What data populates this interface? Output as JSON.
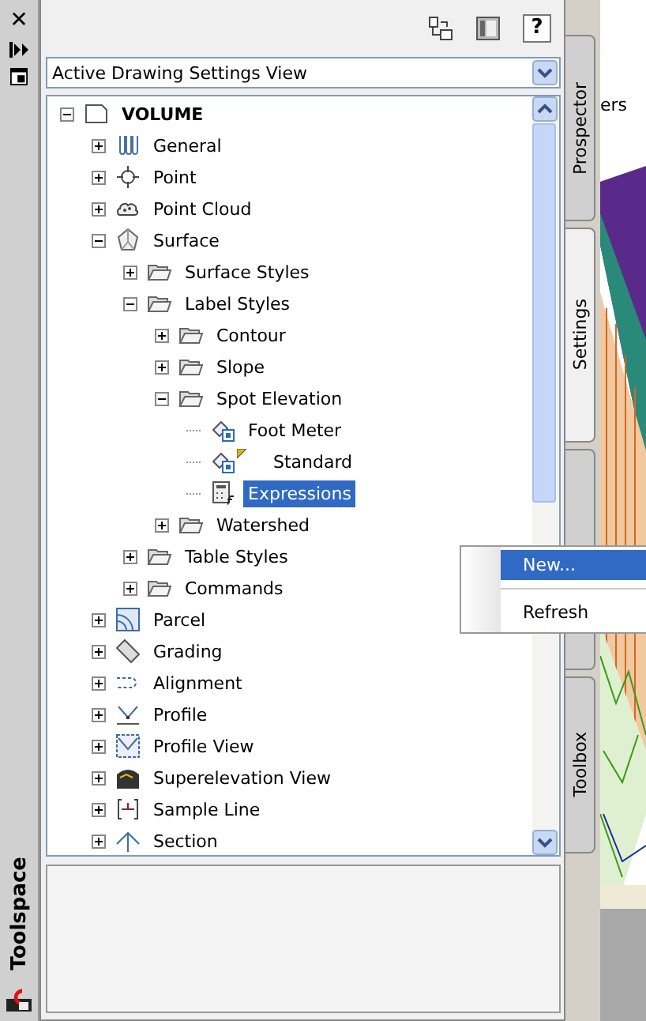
{
  "left_strip": {
    "title": "Toolspace",
    "close_glyph": "✕"
  },
  "toolbar": {
    "buttons": [
      {
        "kind": "tree-toggle"
      },
      {
        "kind": "panel"
      },
      {
        "kind": "help",
        "label": "?"
      }
    ]
  },
  "view_dropdown": {
    "value": "Active Drawing Settings View"
  },
  "tree": [
    {
      "label": "VOLUME",
      "kind": "drawing",
      "expanded": true,
      "selected": false,
      "children": [
        {
          "label": "General",
          "kind": "general",
          "expanded": false,
          "selected": false
        },
        {
          "label": "Point",
          "kind": "point",
          "expanded": false,
          "selected": false
        },
        {
          "label": "Point Cloud",
          "kind": "pointcloud",
          "expanded": false,
          "selected": false
        },
        {
          "label": "Surface",
          "kind": "surface",
          "expanded": true,
          "selected": false,
          "children": [
            {
              "label": "Surface Styles",
              "kind": "folder",
              "expanded": false,
              "selected": false
            },
            {
              "label": "Label Styles",
              "kind": "folder",
              "expanded": true,
              "selected": false,
              "children": [
                {
                  "label": "Contour",
                  "kind": "folder",
                  "expanded": false,
                  "selected": false
                },
                {
                  "label": "Slope",
                  "kind": "folder",
                  "expanded": false,
                  "selected": false
                },
                {
                  "label": "Spot Elevation",
                  "kind": "folder",
                  "expanded": true,
                  "selected": false,
                  "children": [
                    {
                      "label": "Foot Meter",
                      "kind": "label-style",
                      "default": false,
                      "selected": false
                    },
                    {
                      "label": "Standard",
                      "kind": "label-style",
                      "default": true,
                      "selected": false
                    },
                    {
                      "label": "Expressions",
                      "kind": "expressions",
                      "selected": true
                    }
                  ]
                },
                {
                  "label": "Watershed",
                  "kind": "folder",
                  "expanded": false,
                  "selected": false
                }
              ]
            },
            {
              "label": "Table Styles",
              "kind": "folder",
              "expanded": false,
              "selected": false
            },
            {
              "label": "Commands",
              "kind": "folder",
              "expanded": false,
              "selected": false
            }
          ]
        },
        {
          "label": "Parcel",
          "kind": "parcel",
          "expanded": false,
          "selected": false
        },
        {
          "label": "Grading",
          "kind": "grading",
          "expanded": false,
          "selected": false
        },
        {
          "label": "Alignment",
          "kind": "alignment",
          "expanded": false,
          "selected": false
        },
        {
          "label": "Profile",
          "kind": "profile",
          "expanded": false,
          "selected": false
        },
        {
          "label": "Profile View",
          "kind": "profile-view",
          "expanded": false,
          "selected": false
        },
        {
          "label": "Superelevation View",
          "kind": "superelevation",
          "expanded": false,
          "selected": false
        },
        {
          "label": "Sample Line",
          "kind": "sample-line",
          "expanded": false,
          "selected": false
        },
        {
          "label": "Section",
          "kind": "section",
          "expanded": false,
          "selected": false
        }
      ]
    }
  ],
  "side_tabs": [
    {
      "label": "Prospector",
      "selected": false
    },
    {
      "label": "Settings",
      "selected": true
    },
    {
      "selected": false
    },
    {
      "label": "Toolbox",
      "selected": false
    }
  ],
  "background_toolbar": {
    "text": "ers"
  },
  "context_menu": [
    {
      "label": "New...",
      "selected": true
    },
    {
      "label": "Refresh",
      "selected": false
    }
  ]
}
